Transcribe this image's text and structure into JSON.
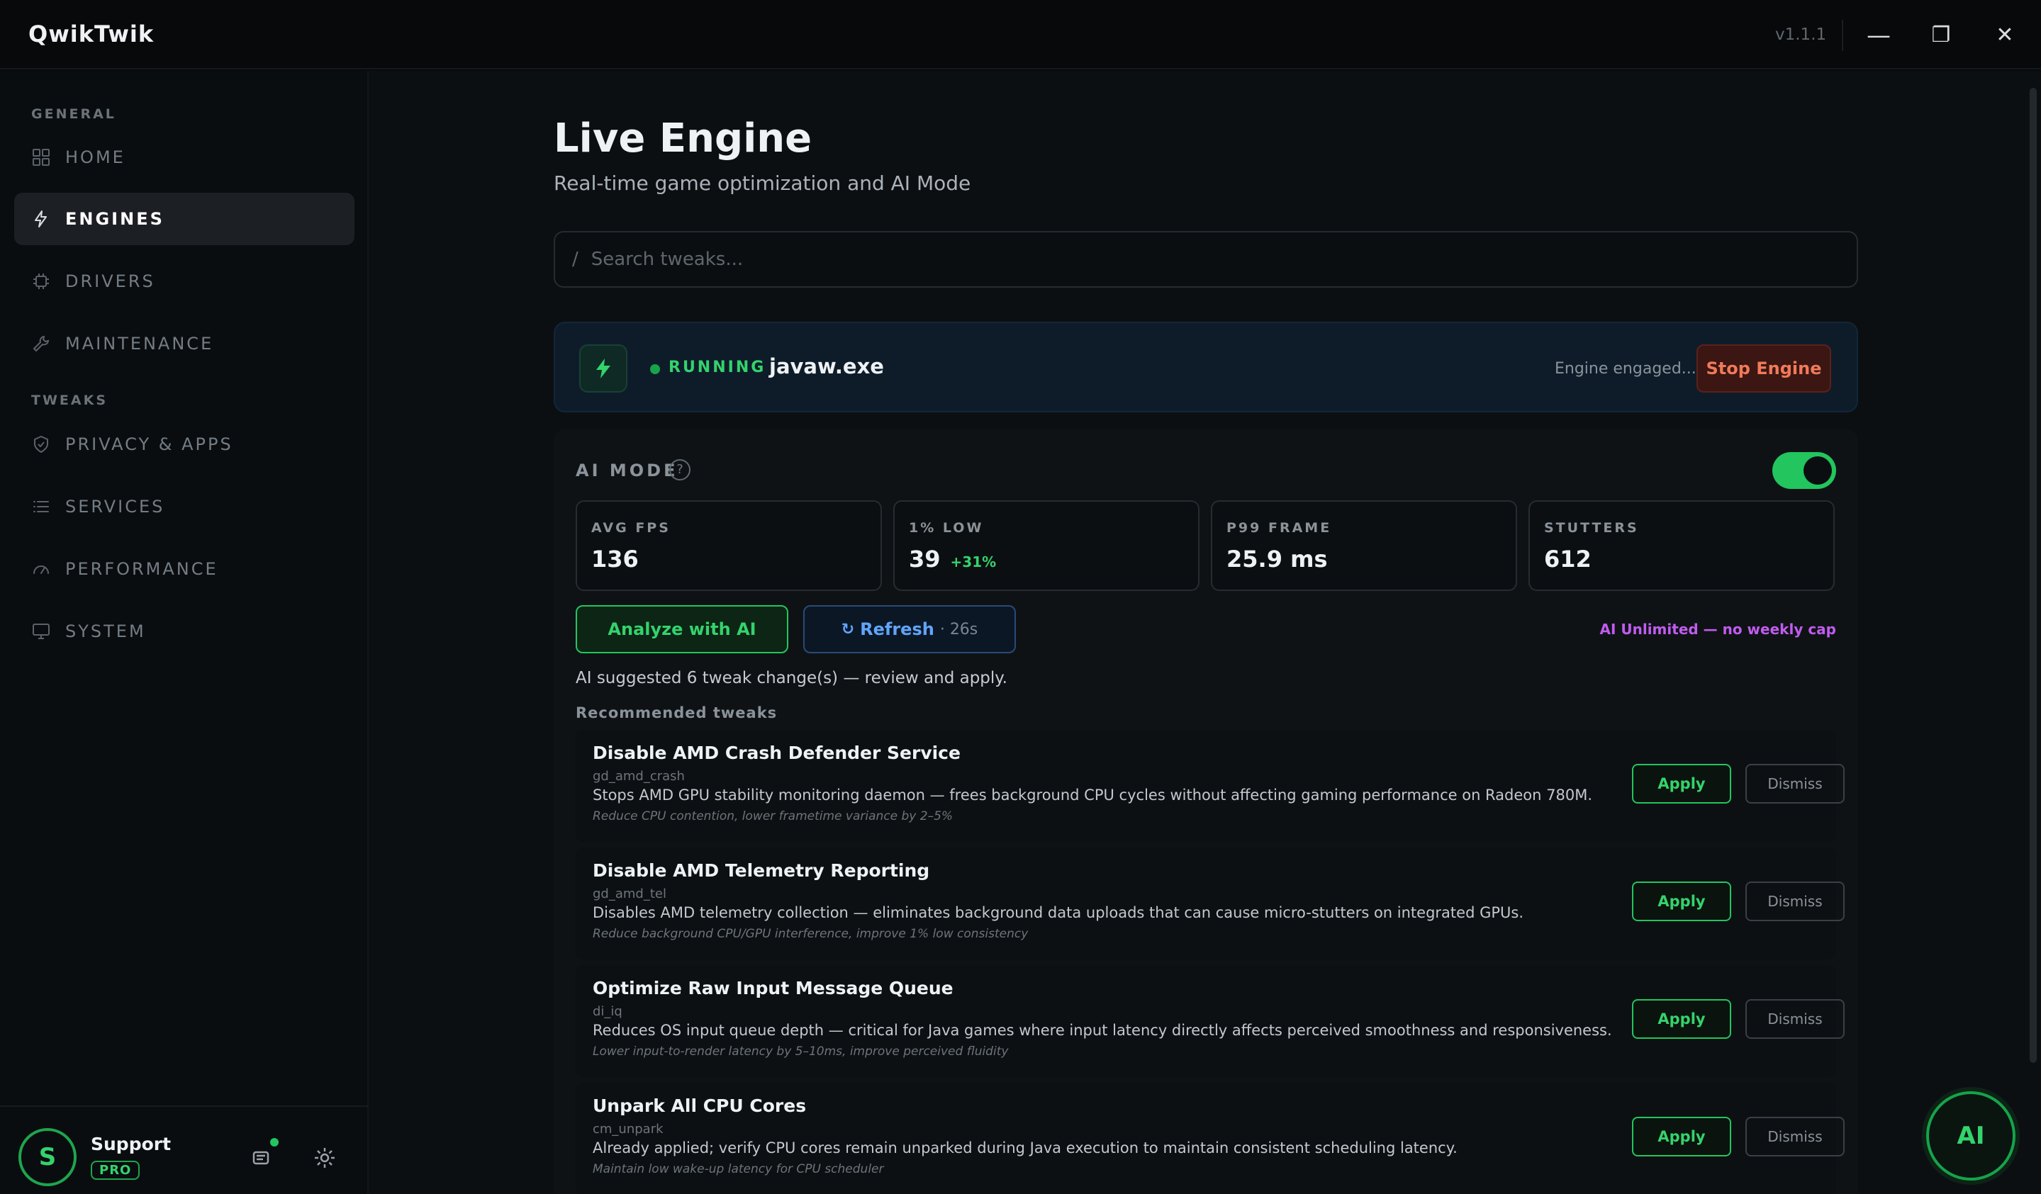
{
  "window": {
    "app_name": "QwikTwik",
    "version": "v1.1.1",
    "minimize_glyph": "—",
    "maximize_glyph": "❐",
    "close_glyph": "✕"
  },
  "sidebar": {
    "sections": [
      {
        "label": "GENERAL"
      },
      {
        "label": "TWEAKS"
      }
    ],
    "items": [
      {
        "label": "HOME",
        "icon": "grid-icon",
        "active": false
      },
      {
        "label": "ENGINES",
        "icon": "lightning-icon",
        "active": true
      },
      {
        "label": "DRIVERS",
        "icon": "chip-icon",
        "active": false
      },
      {
        "label": "MAINTENANCE",
        "icon": "wrench-icon",
        "active": false
      },
      {
        "label": "PRIVACY & APPS",
        "icon": "shield-icon",
        "active": false
      },
      {
        "label": "SERVICES",
        "icon": "list-icon",
        "active": false
      },
      {
        "label": "PERFORMANCE",
        "icon": "gauge-icon",
        "active": false
      },
      {
        "label": "SYSTEM",
        "icon": "monitor-icon",
        "active": false
      }
    ],
    "user": {
      "initial": "S",
      "name": "Support",
      "badge": "PRO"
    }
  },
  "main": {
    "title": "Live Engine",
    "subtitle": "Real-time game optimization and AI Mode",
    "search": {
      "slash": "/",
      "placeholder": "Search tweaks..."
    },
    "engine": {
      "status": "RUNNING",
      "process": "javaw.exe",
      "message": "Engine engaged...",
      "stop_label": "Stop Engine"
    },
    "ai_mode": {
      "title": "AI MODE",
      "help": "?",
      "enabled": true,
      "stats": [
        {
          "label": "AVG FPS",
          "value": "136",
          "delta": ""
        },
        {
          "label": "1% LOW",
          "value": "39",
          "delta": "+31%"
        },
        {
          "label": "P99 FRAME",
          "value": "25.9 ms",
          "delta": ""
        },
        {
          "label": "STUTTERS",
          "value": "612",
          "delta": ""
        }
      ],
      "analyze_label": "Analyze with AI",
      "refresh_label": "Refresh",
      "refresh_countdown": "· 26s",
      "unlimited_text": "AI Unlimited — no weekly cap",
      "suggested_text": "AI suggested 6 tweak change(s) — review and apply.",
      "recommended_label": "Recommended tweaks"
    },
    "tweaks": [
      {
        "title": "Disable AMD Crash Defender Service",
        "id": "gd_amd_crash",
        "desc": "Stops AMD GPU stability monitoring daemon — frees background CPU cycles without affecting gaming performance on Radeon 780M.",
        "benefit": "Reduce CPU contention, lower frametime variance by 2–5%"
      },
      {
        "title": "Disable AMD Telemetry Reporting",
        "id": "gd_amd_tel",
        "desc": "Disables AMD telemetry collection — eliminates background data uploads that can cause micro-stutters on integrated GPUs.",
        "benefit": "Reduce background CPU/GPU interference, improve 1% low consistency"
      },
      {
        "title": "Optimize Raw Input Message Queue",
        "id": "di_iq",
        "desc": "Reduces OS input queue depth — critical for Java games where input latency directly affects perceived smoothness and responsiveness.",
        "benefit": "Lower input-to-render latency by 5–10ms, improve perceived fluidity"
      },
      {
        "title": "Unpark All CPU Cores",
        "id": "cm_unpark",
        "desc": "Already applied; verify CPU cores remain unparked during Java execution to maintain consistent scheduling latency.",
        "benefit": "Maintain low wake-up latency for CPU scheduler"
      }
    ],
    "apply_label": "Apply",
    "dismiss_label": "Dismiss",
    "fab_label": "AI"
  },
  "colors": {
    "accent": "#22c55e",
    "background": "#07090b",
    "danger": "#f07a5a",
    "purple": "#c05cf0",
    "refresh": "#60a5fa"
  }
}
